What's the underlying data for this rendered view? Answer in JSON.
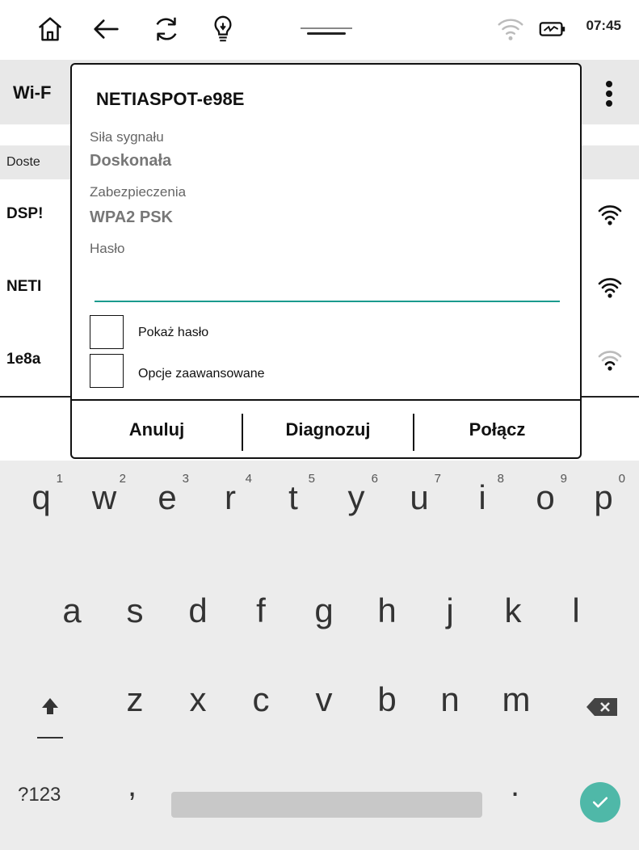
{
  "status_bar": {
    "icons": [
      "home-icon",
      "back-arrow-icon",
      "refresh-icon",
      "lightbulb-icon",
      "wifi-icon",
      "battery-icon"
    ],
    "time": "07:45"
  },
  "wifi_screen": {
    "title": "Wi-F",
    "section_label": "Doste",
    "networks": [
      {
        "name": "DSP!",
        "signal": "full"
      },
      {
        "name": "NETI",
        "signal": "full"
      },
      {
        "name": "1e8a",
        "signal": "weak"
      }
    ]
  },
  "dialog": {
    "title": "NETIASPOT-e98E",
    "signal_label": "Siła sygnału",
    "signal_value": "Doskonała",
    "security_label": "Zabezpieczenia",
    "security_value": "WPA2 PSK",
    "password_label": "Hasło",
    "password_value": "",
    "show_password_label": "Pokaż hasło",
    "advanced_label": "Opcje zaawansowane",
    "buttons": {
      "cancel": "Anuluj",
      "diagnose": "Diagnozuj",
      "connect": "Połącz"
    }
  },
  "keyboard": {
    "row1": [
      {
        "char": "q",
        "num": "1"
      },
      {
        "char": "w",
        "num": "2"
      },
      {
        "char": "e",
        "num": "3"
      },
      {
        "char": "r",
        "num": "4"
      },
      {
        "char": "t",
        "num": "5"
      },
      {
        "char": "y",
        "num": "6"
      },
      {
        "char": "u",
        "num": "7"
      },
      {
        "char": "i",
        "num": "8"
      },
      {
        "char": "o",
        "num": "9"
      },
      {
        "char": "p",
        "num": "0"
      }
    ],
    "row2": [
      "a",
      "s",
      "d",
      "f",
      "g",
      "h",
      "j",
      "k",
      "l"
    ],
    "row3": [
      "z",
      "x",
      "c",
      "v",
      "b",
      "n",
      "m"
    ],
    "symbols_key": "?123",
    "comma_key": ",",
    "period_key": ".",
    "accent_color": "#4fb8a8"
  }
}
